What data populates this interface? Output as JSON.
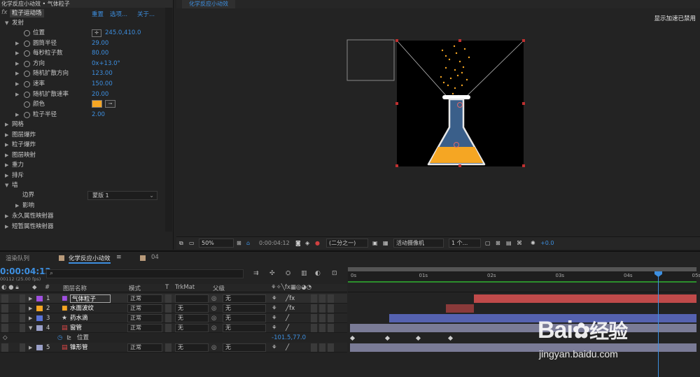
{
  "effect_panel": {
    "title": "化学反应小动效 • 气体粒子",
    "fx_label": "fx",
    "effect_name": "粒子运动场",
    "links": [
      "重置",
      "选项...",
      "关于..."
    ],
    "section_emit": "发射",
    "properties": [
      {
        "label": "位置",
        "value": "245.0,410.0",
        "twirl": false
      },
      {
        "label": "圆筒半径",
        "value": "29.00",
        "twirl": true
      },
      {
        "label": "每秒粒子数",
        "value": "80.00",
        "twirl": true
      },
      {
        "label": "方向",
        "value": "0x+13.0°",
        "twirl": true
      },
      {
        "label": "随机扩散方向",
        "value": "123.00",
        "twirl": true
      },
      {
        "label": "速率",
        "value": "150.00",
        "twirl": true
      },
      {
        "label": "随机扩散速率",
        "value": "20.00",
        "twirl": true
      },
      {
        "label": "颜色",
        "value": "",
        "twirl": false
      },
      {
        "label": "粒子半径",
        "value": "2.00",
        "twirl": true
      }
    ],
    "color_value": "#f5a623",
    "sections": [
      "网格",
      "图层爆炸",
      "粒子爆炸",
      "图层映射",
      "重力",
      "排斥"
    ],
    "wall": "墙",
    "boundary_label": "边界",
    "boundary_value": "蒙版 1",
    "influence": "影响",
    "bottom_sections": [
      "永久属性映射器",
      "短暂属性映射器"
    ]
  },
  "viewer": {
    "tab": "化学反应小动效",
    "gpu_notice": "显示加速已禁用",
    "toolbar": {
      "zoom": "50%",
      "timecode": "0:00:04:12",
      "resolution": "(二分之一)",
      "camera": "活动摄像机",
      "views": "1 个...",
      "exposure": "+0.0"
    }
  },
  "timeline": {
    "tabs": [
      "渲染队列",
      "化学反应小动效",
      "04"
    ],
    "timecode": "0:00:04:12",
    "frame_info": "00112 (25.00 fps)",
    "search_placeholder": "",
    "headers": {
      "name": "图层名称",
      "mode": "模式",
      "t": "T",
      "trkmat": "TrkMat",
      "parent": "父级"
    },
    "ruler": [
      "0s",
      "01s",
      "02s",
      "03s",
      "04s",
      "05s"
    ],
    "layers": [
      {
        "num": "1",
        "name": "气体粒子",
        "mode": "正常",
        "trkmat": "",
        "parent": "无",
        "label_color": "#a050e0",
        "icon": "solid",
        "selected": true
      },
      {
        "num": "2",
        "name": "水面波纹",
        "mode": "正常",
        "trkmat": "无",
        "parent": "无",
        "label_color": "#f5a623",
        "icon": "solid",
        "selected": false
      },
      {
        "num": "3",
        "name": "药水滴",
        "mode": "正常",
        "trkmat": "无",
        "parent": "无",
        "label_color": "#5a73d8",
        "icon": "shape",
        "selected": false
      },
      {
        "num": "4",
        "name": "窗管",
        "mode": "正常",
        "trkmat": "无",
        "parent": "无",
        "label_color": "#9aa0c8",
        "icon": "ai",
        "selected": false
      },
      {
        "num": "5",
        "name": "锥形管",
        "mode": "正常",
        "trkmat": "无",
        "parent": "无",
        "label_color": "#9aa0c8",
        "icon": "ai",
        "selected": false
      }
    ],
    "position_prop": {
      "label": "位置",
      "value": "-101.5,77.0"
    },
    "watermark": {
      "brand": "Bai",
      "brand2": "经验",
      "url": "jingyan.baidu.com"
    }
  }
}
